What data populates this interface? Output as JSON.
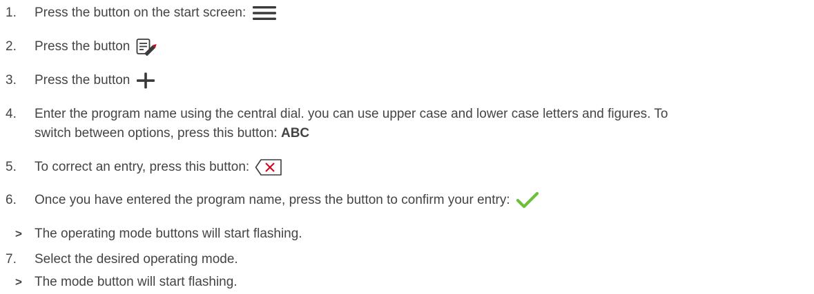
{
  "steps": [
    {
      "marker": "1.",
      "text": "Press the button on the start screen:",
      "icon": "menu-icon"
    },
    {
      "marker": "2.",
      "text": "Press the button",
      "icon": "edit-list-icon"
    },
    {
      "marker": "3.",
      "text": "Press the button",
      "icon": "plus-icon"
    },
    {
      "marker": "4.",
      "text_line1": "Enter the program name using the central dial. you can use upper case and lower case letters and figures. To",
      "text_line2": "switch between options, press this button:",
      "bold": "ABC"
    },
    {
      "marker": "5.",
      "text": "To correct an entry, press this button:",
      "icon": "backspace-icon"
    },
    {
      "marker": "6.",
      "text": "Once you have entered the program name, press the button to confirm your entry:",
      "icon": "checkmark-icon"
    },
    {
      "marker": ">",
      "text": "The operating mode buttons will start flashing."
    },
    {
      "marker": "7.",
      "text": "Select the desired operating mode."
    },
    {
      "marker": ">",
      "text": "The mode button will start flashing."
    }
  ],
  "colors": {
    "text": "#444444",
    "icon_dark": "#3a3a3a",
    "backspace_x": "#d6001c",
    "pencil_tip": "#d6001c",
    "check": "#6abf3b"
  }
}
